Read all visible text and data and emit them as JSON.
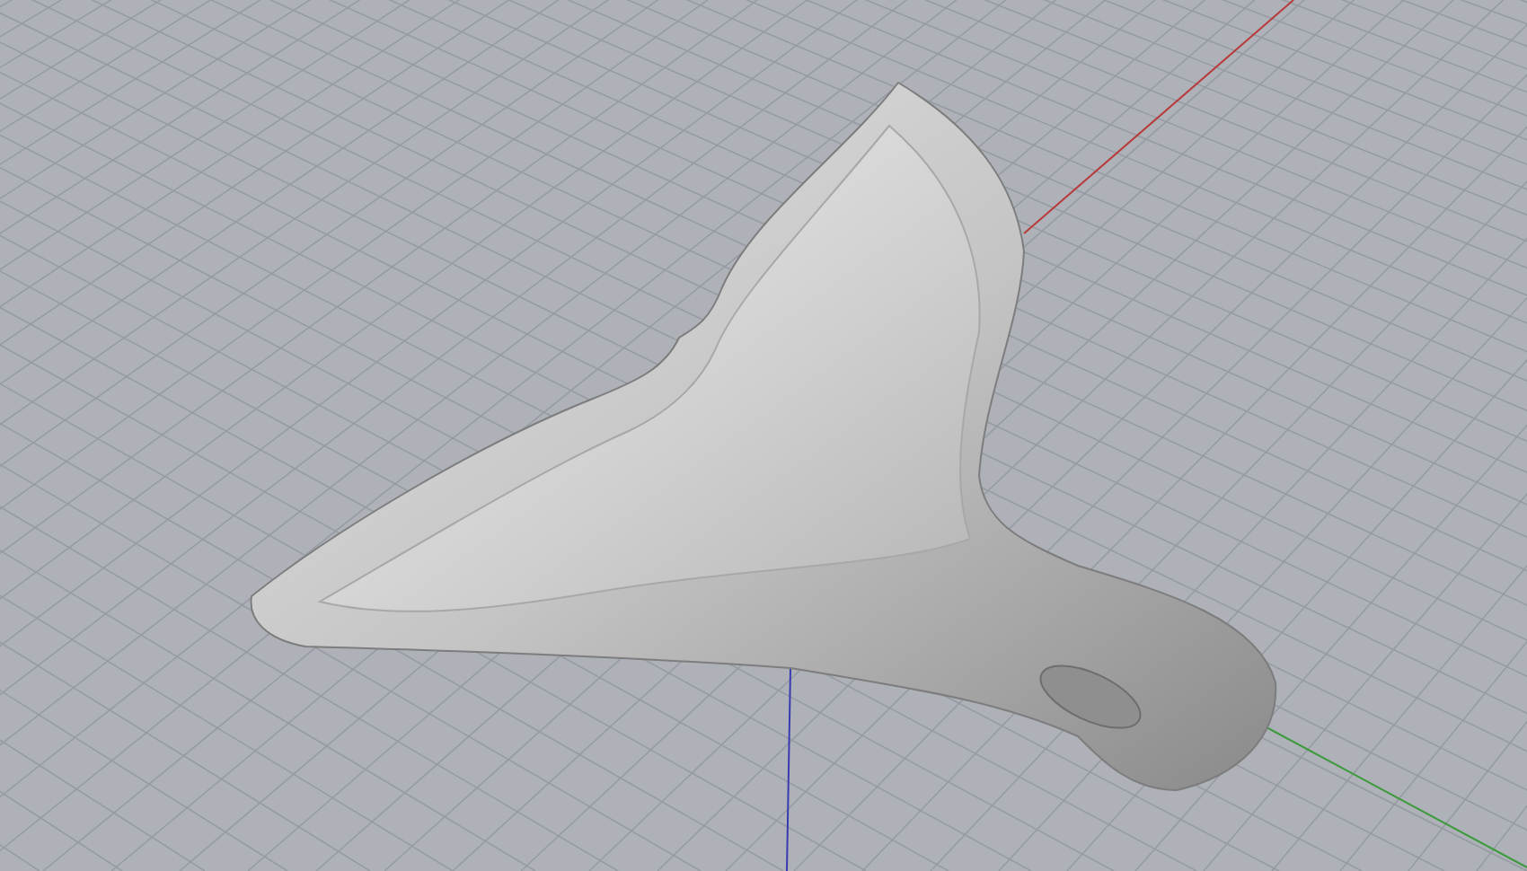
{
  "viewport": {
    "axes": [
      {
        "kind": "x",
        "color": "#b83a3a"
      },
      {
        "kind": "y",
        "color": "#3f9a3f"
      },
      {
        "kind": "z",
        "color": "#3a3ab0"
      }
    ]
  }
}
